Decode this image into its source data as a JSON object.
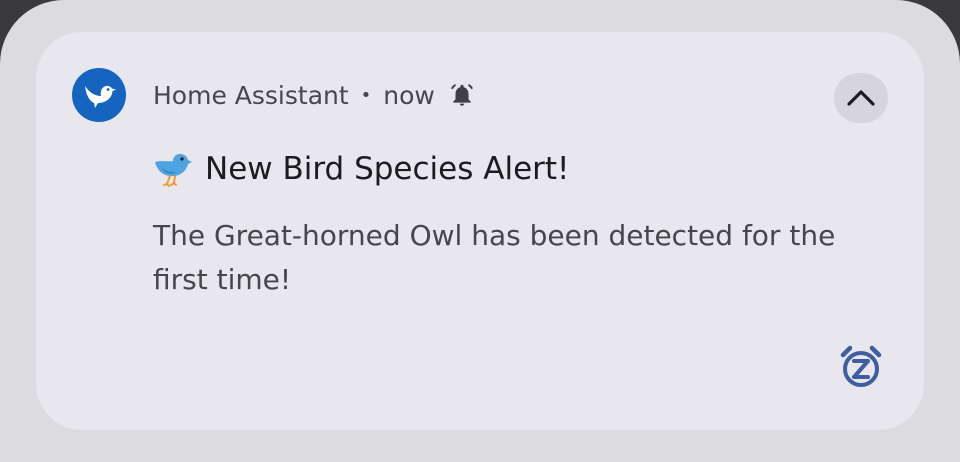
{
  "notification": {
    "app_name": "Home Assistant",
    "separator": "•",
    "time": "now",
    "title_emoji_icon": "bird-emoji-icon",
    "title": "New Bird Species Alert!",
    "body": "The Great-horned Owl has been detected for the first time!",
    "app_icon": "home-assistant-bird-icon",
    "app_icon_color": "#1565c0",
    "expand_icon": "chevron-up-icon",
    "status_icon": "alert-bell-icon",
    "snooze_icon": "snooze-alarm-icon",
    "accent_color": "#3d5ea0"
  }
}
